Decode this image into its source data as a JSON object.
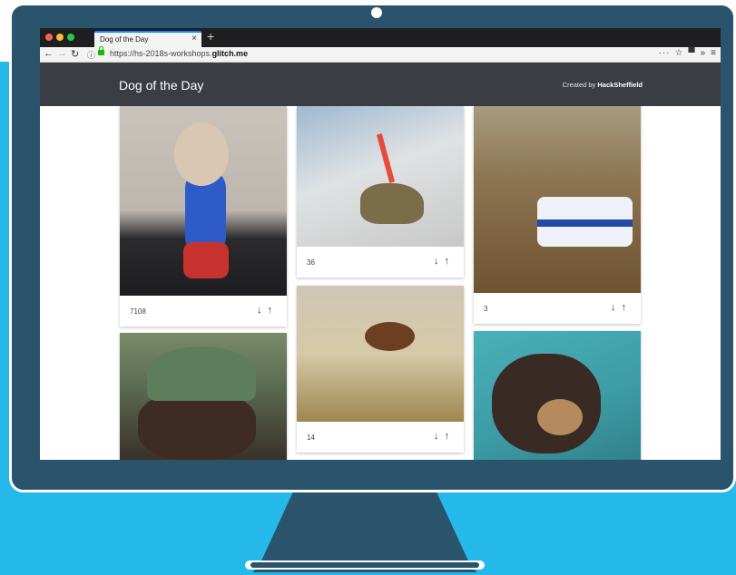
{
  "browser": {
    "tab_title": "Dog of the Day",
    "tab_close": "×",
    "new_tab": "+",
    "url_prefix": "https://hs-2018s-workshops.",
    "url_domain": "glitch.me",
    "more_glyph": "···",
    "star_glyph": "☆",
    "library_glyph": "▀",
    "overflow_glyph": "»",
    "menu_glyph": "≡"
  },
  "app": {
    "title": "Dog of the Day",
    "credit_prefix": "Created by ",
    "credit_name": "HackSheffield"
  },
  "cards": [
    {
      "votes": "7108",
      "photo": "chihuahua-superhero-treadmill"
    },
    {
      "votes": "36",
      "photo": "cat-laser-pointer"
    },
    {
      "votes": "3",
      "photo": "dog-toy-police-car"
    },
    {
      "votes": "",
      "photo": "dog-wearing-beanie"
    },
    {
      "votes": "14",
      "photo": "dog-flying-midair"
    },
    {
      "votes": "",
      "photo": "chihuahua-sleepy-pool"
    }
  ],
  "arrows": {
    "down": "↓",
    "up": "↑"
  },
  "colors": {
    "appbar": "#3a3e44",
    "backdrop": "#25b9ea",
    "monitor": "#2a536c"
  }
}
